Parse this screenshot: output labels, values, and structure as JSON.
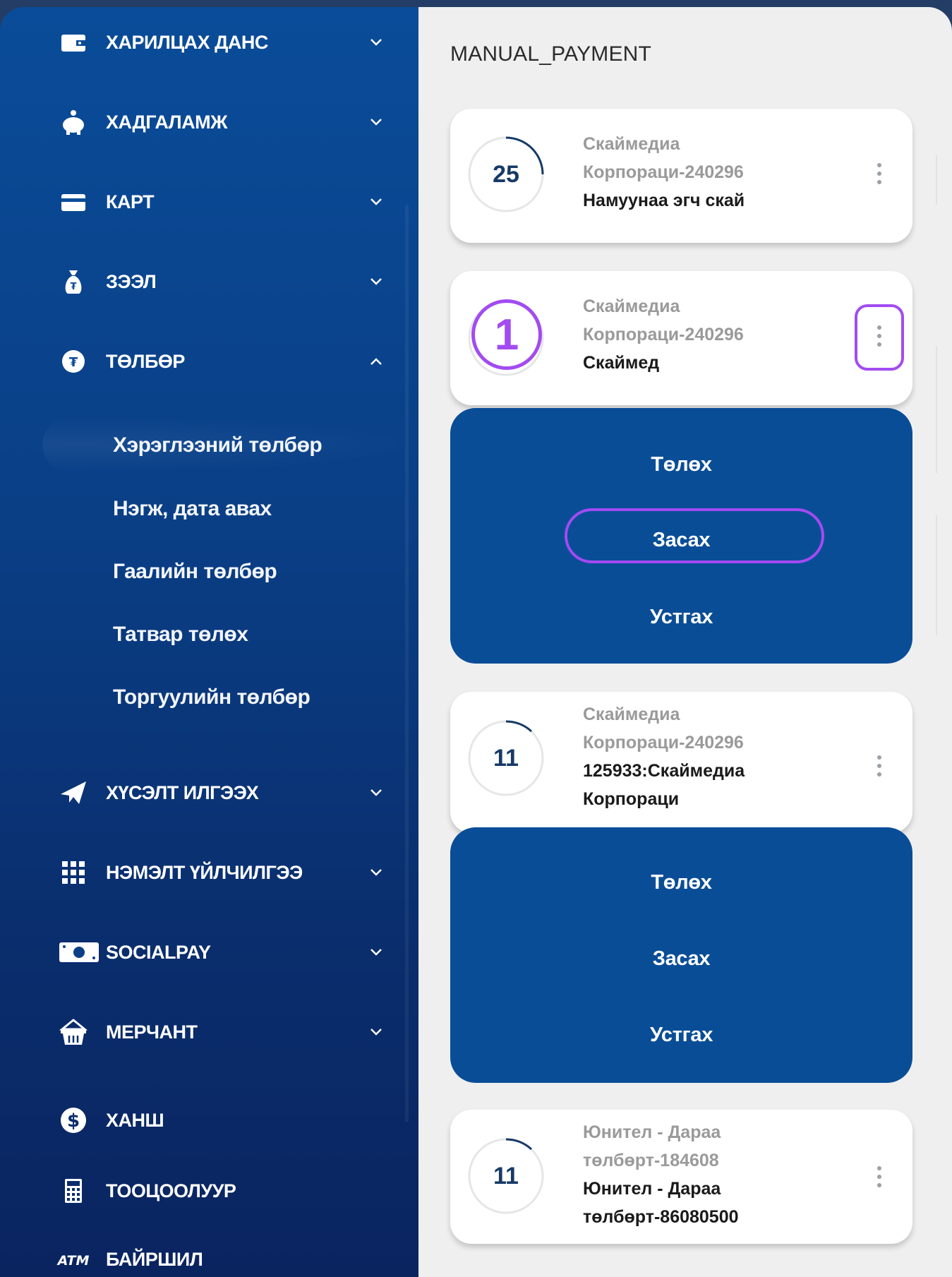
{
  "sidebar": {
    "items": [
      {
        "label": "ХАРИЛЦАХ ДАНС",
        "icon": "wallet-icon"
      },
      {
        "label": "ХАДГАЛАМЖ",
        "icon": "piggy-bank-icon"
      },
      {
        "label": "КАРТ",
        "icon": "card-icon"
      },
      {
        "label": "ЗЭЭЛ",
        "icon": "money-bag-icon"
      },
      {
        "label": "ТӨЛБӨР",
        "icon": "payment-coin-icon"
      },
      {
        "label": "ХҮСЭЛТ ИЛГЭЭХ",
        "icon": "paper-plane-icon"
      },
      {
        "label": "НЭМЭЛТ ҮЙЛЧИЛГЭЭ",
        "icon": "grid-icon"
      },
      {
        "label": "SOCIALPAY",
        "icon": "cash-icon"
      },
      {
        "label": "МЕРЧАНТ",
        "icon": "basket-icon"
      },
      {
        "label": "ХАНШ",
        "icon": "dollar-icon"
      },
      {
        "label": "ТООЦООЛУУР",
        "icon": "calculator-icon"
      },
      {
        "label": "БАЙРШИЛ",
        "icon": "atm-icon"
      }
    ],
    "payment_sub": [
      "Хэрэглээний төлбөр",
      "Нэгж, дата авах",
      "Гаалийн төлбөр",
      "Татвар төлөх",
      "Торгуулийн төлбөр"
    ]
  },
  "main": {
    "title": "MANUAL_PAYMENT",
    "cards": [
      {
        "badge": "25",
        "lines": [
          "Скаймедиа",
          "Корпораци-240296"
        ],
        "name_lines": [
          "Намуунаа эгч скай"
        ]
      },
      {
        "badge": "",
        "lines": [
          "Скаймедиа",
          "Корпораци-240296"
        ],
        "name_lines": [
          "Скаймед"
        ]
      },
      {
        "badge": "11",
        "lines": [
          "Скаймедиа",
          "Корпораци-240296"
        ],
        "name_lines": [
          "125933:Скаймедиа",
          "Корпораци"
        ]
      },
      {
        "badge": "11",
        "lines": [
          "Юнител - Дараа",
          "төлбөрт-184608"
        ],
        "name_lines": [
          "Юнител - Дараа",
          "төлбөрт-86080500"
        ]
      }
    ],
    "actions": {
      "pay": "Төлөх",
      "edit": "Засах",
      "delete": "Устгах"
    }
  },
  "annotation": {
    "step": "1",
    "color": "#a24bf1"
  }
}
